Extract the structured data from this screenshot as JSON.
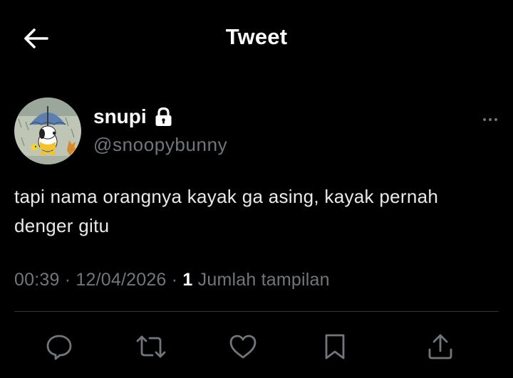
{
  "header": {
    "title": "Tweet"
  },
  "icons": {
    "back": "arrow-left-icon",
    "lock": "lock-icon",
    "more": "ellipsis-icon",
    "reply": "reply-icon",
    "retweet": "retweet-icon",
    "like": "heart-icon",
    "bookmark": "bookmark-icon",
    "share": "share-icon"
  },
  "user": {
    "display_name": "snupi",
    "handle": "@snoopybunny",
    "protected": true
  },
  "tweet": {
    "text": "tapi nama orangnya kayak ga asing, kayak pernah denger gitu",
    "time": "00:39",
    "separator": "·",
    "date": "12/04/2026",
    "views_count": "1",
    "views_label": "Jumlah tampilan"
  },
  "colors": {
    "background": "#000000",
    "text_primary": "#ffffff",
    "text_secondary": "#71767b",
    "divider": "#2f3336"
  }
}
